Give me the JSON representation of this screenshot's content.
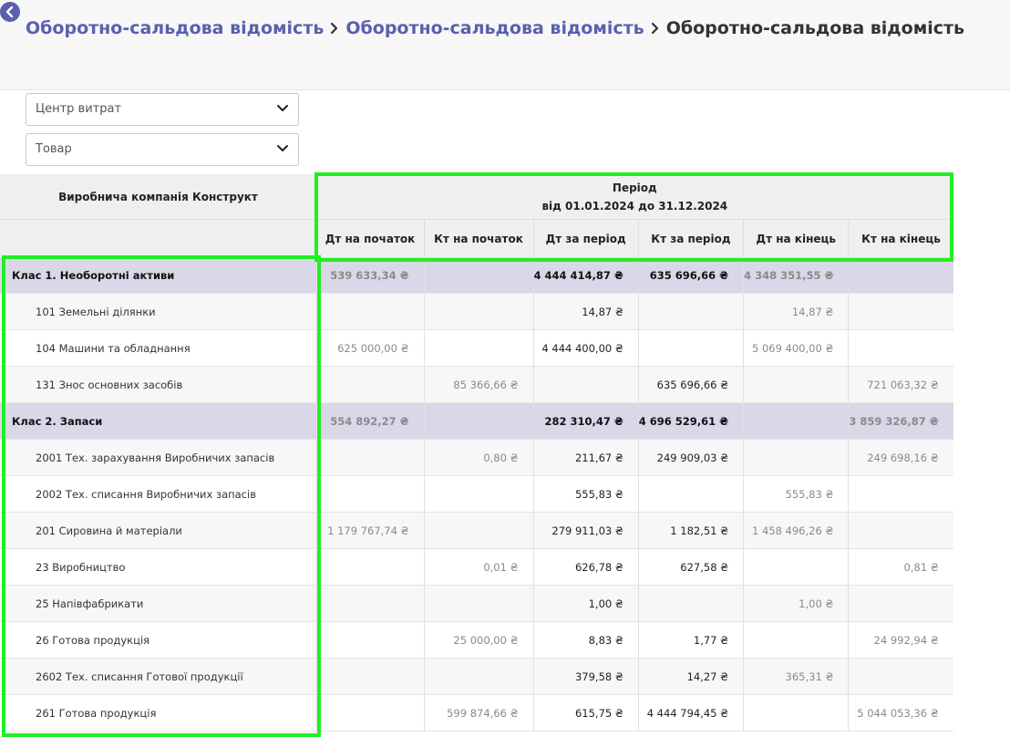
{
  "breadcrumb": {
    "items": [
      "Оборотно-сальдова відомість",
      "Оборотно-сальдова відомість"
    ],
    "current": "Оборотно-сальдова відомість"
  },
  "filters": {
    "cost_center": "Центр витрат",
    "product": "Товар"
  },
  "table": {
    "company": "Виробнича компанія Конструкт",
    "period_title": "Період",
    "period_range": "від 01.01.2024 до 31.12.2024",
    "columns": [
      "Дт на початок",
      "Кт на початок",
      "Дт за період",
      "Кт за період",
      "Дт на кінець",
      "Кт на кінець"
    ],
    "rows": [
      {
        "type": "class",
        "name": "Клас 1. Необоротні активи",
        "values": [
          "539 633,34 ₴",
          "",
          "4 444 414,87 ₴",
          "635 696,66 ₴",
          "4 348 351,55 ₴",
          ""
        ]
      },
      {
        "type": "sub",
        "name": "101 Земельні ділянки",
        "values": [
          "",
          "",
          "14,87 ₴",
          "",
          "14,87 ₴",
          ""
        ]
      },
      {
        "type": "sub",
        "name": "104 Машини та обладнання",
        "values": [
          "625 000,00 ₴",
          "",
          "4 444 400,00 ₴",
          "",
          "5 069 400,00 ₴",
          ""
        ]
      },
      {
        "type": "sub",
        "name": "131 Знос основних засобів",
        "values": [
          "",
          "85 366,66 ₴",
          "",
          "635 696,66 ₴",
          "",
          "721 063,32 ₴"
        ]
      },
      {
        "type": "class",
        "name": "Клас 2. Запаси",
        "values": [
          "554 892,27 ₴",
          "",
          "282 310,47 ₴",
          "4 696 529,61 ₴",
          "",
          "3 859 326,87 ₴"
        ]
      },
      {
        "type": "sub",
        "name": "2001 Тех. зарахування Виробничих запасів",
        "values": [
          "",
          "0,80 ₴",
          "211,67 ₴",
          "249 909,03 ₴",
          "",
          "249 698,16 ₴"
        ]
      },
      {
        "type": "sub",
        "name": "2002 Тех. списання Виробничих запасів",
        "values": [
          "",
          "",
          "555,83 ₴",
          "",
          "555,83 ₴",
          ""
        ]
      },
      {
        "type": "sub",
        "name": "201 Сировина й матеріали",
        "values": [
          "1 179 767,74 ₴",
          "",
          "279 911,03 ₴",
          "1 182,51 ₴",
          "1 458 496,26 ₴",
          ""
        ]
      },
      {
        "type": "sub",
        "name": "23 Виробництво",
        "values": [
          "",
          "0,01 ₴",
          "626,78 ₴",
          "627,58 ₴",
          "",
          "0,81 ₴"
        ]
      },
      {
        "type": "sub",
        "name": "25 Напівфабрикати",
        "values": [
          "",
          "",
          "1,00 ₴",
          "",
          "1,00 ₴",
          ""
        ]
      },
      {
        "type": "sub",
        "name": "26 Готова продукція",
        "values": [
          "",
          "25 000,00 ₴",
          "8,83 ₴",
          "1,77 ₴",
          "",
          "24 992,94 ₴"
        ]
      },
      {
        "type": "sub",
        "name": "2602 Тех. списання Готової продукції",
        "values": [
          "",
          "",
          "379,58 ₴",
          "14,27 ₴",
          "365,31 ₴",
          ""
        ]
      },
      {
        "type": "sub",
        "name": "261 Готова продукція",
        "values": [
          "",
          "599 874,66 ₴",
          "615,75 ₴",
          "4 444 794,45 ₴",
          "",
          "5 044 053,36 ₴"
        ]
      }
    ]
  },
  "colors": {
    "link": "#5a5fb0",
    "class_row_bg": "#d9d8e8",
    "highlight": "#22ee22"
  }
}
